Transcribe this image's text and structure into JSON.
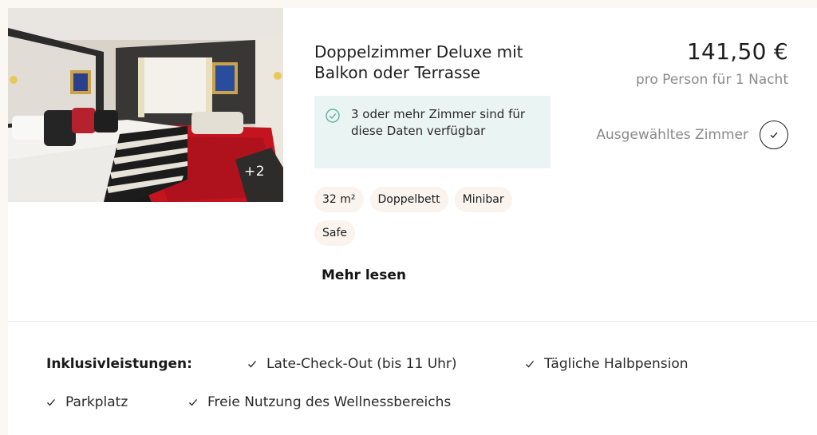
{
  "room": {
    "title": "Doppelzimmer Deluxe mit Balkon oder Terrasse",
    "photo_count": "+2",
    "availability": "3 oder mehr Zimmer sind für diese Daten verfügbar",
    "tags": [
      "32 m²",
      "Doppelbett",
      "Minibar",
      "Safe"
    ],
    "read_more": "Mehr lesen"
  },
  "pricing": {
    "price": "141,50 €",
    "per": "pro Person für 1 Nacht",
    "selected_label": "Ausgewähltes Zimmer"
  },
  "inclusions": {
    "title": "Inklusivleistungen:",
    "items": [
      "Late-Check-Out (bis 11 Uhr)",
      "Tägliche Halbpension",
      "Parkplatz",
      "Freie Nutzung des Wellnessbereichs"
    ]
  },
  "colors": {
    "accent_teal": "#5fb3a3",
    "availability_bg": "#eaf4f2",
    "tag_bg": "#faf3ee",
    "muted_text": "#8a8a8a"
  },
  "icons": {
    "availability": "check-circle-icon",
    "selected": "check-circle-outline-icon",
    "inclusion": "check-icon"
  }
}
